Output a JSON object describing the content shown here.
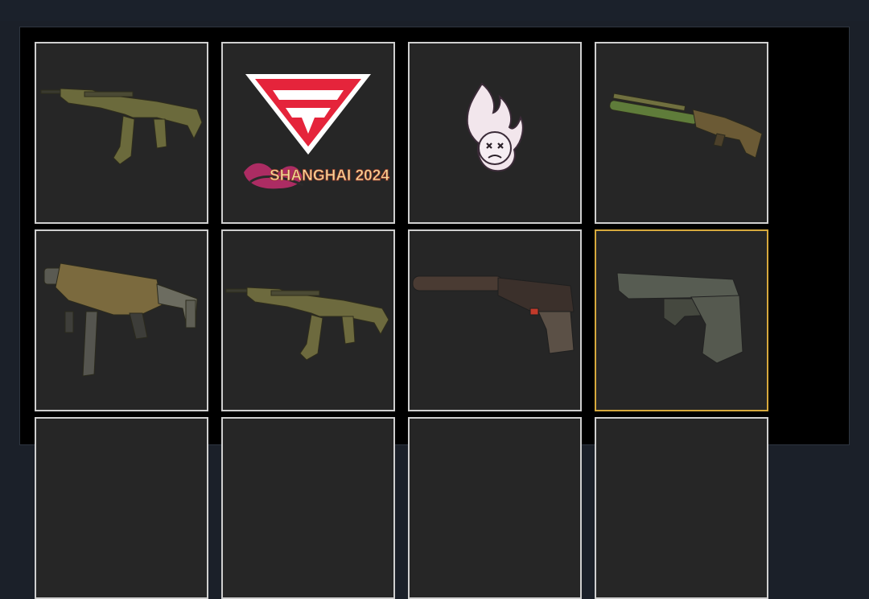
{
  "window": {
    "background": "#1b2029",
    "panel_background": "#000000"
  },
  "inventory": {
    "selected_index": 7,
    "accent_selected": "#d6a93d",
    "slot_border": "#cfcfcf",
    "slot_background": "#262626",
    "items": [
      {
        "icon": "rifle-icon"
      },
      {
        "icon": "team-sticker-icon",
        "sticker_text": "SHANGHAI 2024"
      },
      {
        "icon": "flame-skull-icon"
      },
      {
        "icon": "shotgun-icon"
      },
      {
        "icon": "smg-icon"
      },
      {
        "icon": "rifle-icon"
      },
      {
        "icon": "silenced-pistol-icon"
      },
      {
        "icon": "pistol-icon"
      },
      {
        "icon": "empty-slot"
      },
      {
        "icon": "empty-slot"
      },
      {
        "icon": "empty-slot"
      },
      {
        "icon": "empty-slot"
      }
    ]
  }
}
